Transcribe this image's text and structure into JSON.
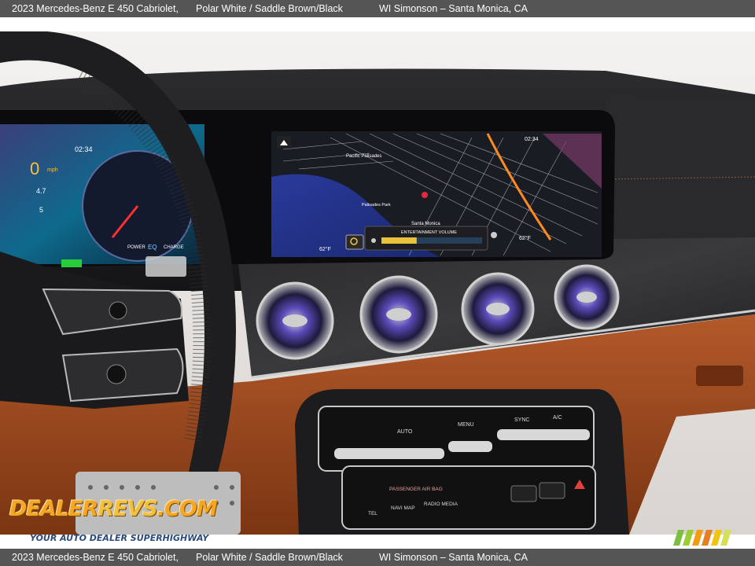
{
  "caption": {
    "vehicle": "2023 Mercedes-Benz E 450 Cabriolet,",
    "color": "Polar White / Saddle Brown/Black",
    "dealer": "WI Simonson – Santa Monica, CA"
  },
  "cluster": {
    "time": "02:34",
    "speed": "0",
    "speed_unit": "mph",
    "trip": "4.7",
    "gear": "5",
    "mode_power": "POWER",
    "mode_eq": "EQ",
    "mode_charge": "CHARGE"
  },
  "nav": {
    "time": "02:34",
    "temp_left": "62°F",
    "temp_right": "62°F",
    "label_palisades": "Pacific Palisades",
    "label_santa_monica": "Santa Monica",
    "label_pier": "Palisades Park",
    "volume_label": "ENTERTAINMENT VOLUME",
    "volume_level": 0.35
  },
  "console": {
    "btn_auto": "AUTO",
    "btn_menu": "MENU",
    "btn_sync": "SYNC",
    "btn_ac": "A/C",
    "btn_tel": "TEL",
    "btn_navi": "NAVI MAP",
    "btn_radio": "RADIO MEDIA",
    "passenger": "PASSENGER AIR BAG"
  },
  "watermark": {
    "brand_a": "DEALER",
    "brand_b": "REVS",
    "brand_c": ".COM",
    "tagline": "YOUR AUTO DEALER SUPERHIGHWAY"
  }
}
